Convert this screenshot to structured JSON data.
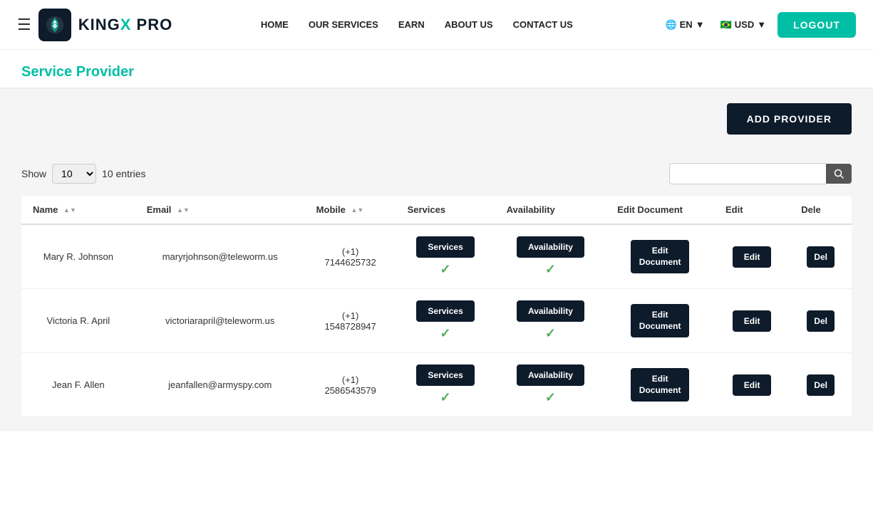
{
  "nav": {
    "brand": "KINGX PRO",
    "brand_prefix": "KING",
    "brand_x": "X",
    "brand_suffix": " PRO",
    "links": [
      {
        "label": "HOME",
        "id": "home"
      },
      {
        "label": "OUR SERVICES",
        "id": "our-services"
      },
      {
        "label": "EARN",
        "id": "earn"
      },
      {
        "label": "ABOUT US",
        "id": "about-us"
      },
      {
        "label": "CONTACT US",
        "id": "contact-us"
      }
    ],
    "lang": "EN",
    "currency": "USD",
    "logout": "LOGOUT"
  },
  "page": {
    "title": "Service Provider",
    "add_button": "ADD PROVIDER"
  },
  "table": {
    "show_label": "Show",
    "entries_label": "10 entries",
    "show_value": "10",
    "columns": [
      "Name",
      "Email",
      "Mobile",
      "Services",
      "Availability",
      "Edit Document",
      "Edit",
      "Dele"
    ],
    "rows": [
      {
        "name": "Mary R. Johnson",
        "email": "maryrjohnson@teleworm.us",
        "mobile": "(+1)\n7144625732",
        "services_btn": "Services",
        "availability_btn": "Availability",
        "edit_doc_btn": "Edit\nDocument",
        "edit_btn": "Edit",
        "del_btn": "Del"
      },
      {
        "name": "Victoria R. April",
        "email": "victoriarapril@teleworm.us",
        "mobile": "(+1)\n1548728947",
        "services_btn": "Services",
        "availability_btn": "Availability",
        "edit_doc_btn": "Edit\nDocument",
        "edit_btn": "Edit",
        "del_btn": "Del"
      },
      {
        "name": "Jean F. Allen",
        "email": "jeanfallen@armyspy.com",
        "mobile": "(+1)\n2586543579",
        "services_btn": "Services",
        "availability_btn": "Availability",
        "edit_doc_btn": "Edit\nDocument",
        "edit_btn": "Edit",
        "del_btn": "Del"
      }
    ]
  }
}
